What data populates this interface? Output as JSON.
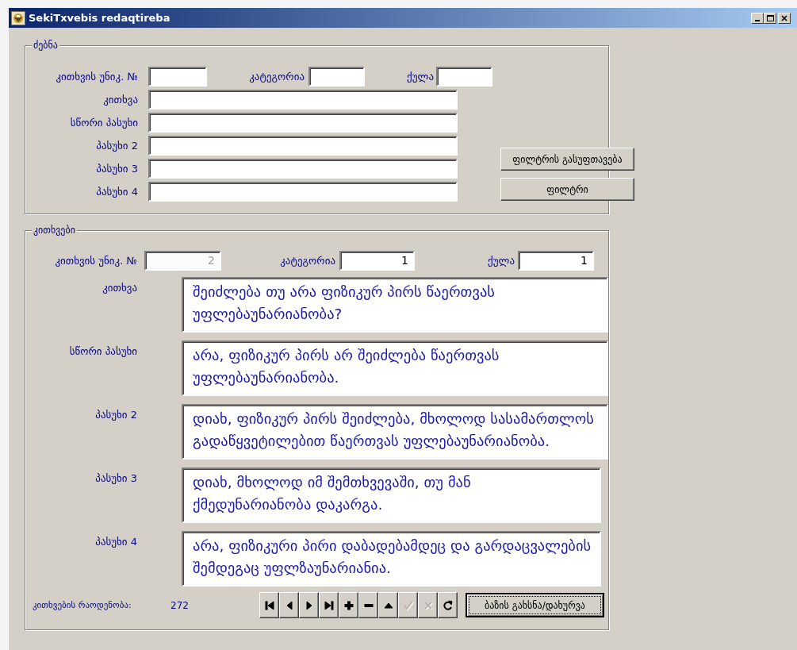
{
  "window": {
    "title": "SekiTxvebis redaqtireba"
  },
  "search": {
    "title": "ძებნა",
    "top_fields": [
      {
        "label": "კითხვის უნიკ. №"
      },
      {
        "label": "კატეგორია"
      },
      {
        "label": "ქულა"
      }
    ],
    "fields": [
      {
        "label": "კითხვა"
      },
      {
        "label": "სწორი პასუხი"
      },
      {
        "label": "პასუხი 2"
      },
      {
        "label": "პასუხი 3"
      },
      {
        "label": "პასუხი 4"
      }
    ],
    "buttons": [
      "ფილტრის გასუფთავება",
      "ფილტრი"
    ]
  },
  "questions": {
    "title": "კითხვები",
    "top_fields": [
      {
        "label": "კითხვის უნიკ. №",
        "value": "2",
        "disabled": true
      },
      {
        "label": "კატეგორია",
        "value": "1",
        "disabled": false
      },
      {
        "label": "ქულა",
        "value": "1",
        "disabled": false
      }
    ],
    "memos": [
      {
        "label": "კითხვა",
        "value": "შეიძლება თუ არა ფიზიკურ პირს წაერთვას უფლებაუნარიანობა?",
        "narrow": false
      },
      {
        "label": "სწორი პასუხი",
        "value": "არა, ფიზიკურ პირს არ შეიძლება წაერთვას უფლებაუნარიანობა.",
        "narrow": false
      },
      {
        "label": "პასუხი 2",
        "value": "დიახ, ფიზიკურ პირს შეიძლება, მხოლოდ სასამართლოს გადაწყვეტილებით წაერთვას უფლებაუნარიანობა.",
        "narrow": false
      },
      {
        "label": "პასუხი 3",
        "value": "დიახ, მხოლოდ იმ შემთხვევაში, თუ მან ქმედუნარიანობა დაკარგა.",
        "narrow": true
      },
      {
        "label": "პასუხი 4",
        "value": "არა, ფიზიკური პირი დაბადებამდეც და გარდაცვალების შემდეგაც უფლზაუნარიანია.",
        "narrow": true
      }
    ],
    "count_label": "კითხვების რაოდენობა:",
    "count": "272",
    "navigator": [
      {
        "kind": "first",
        "disabled": false
      },
      {
        "kind": "prior",
        "disabled": false
      },
      {
        "kind": "next",
        "disabled": false
      },
      {
        "kind": "last",
        "disabled": false
      },
      {
        "kind": "insert",
        "disabled": false
      },
      {
        "kind": "delete",
        "disabled": false
      },
      {
        "kind": "edit",
        "disabled": false
      },
      {
        "kind": "post",
        "disabled": true
      },
      {
        "kind": "cancel",
        "disabled": true
      },
      {
        "kind": "refresh",
        "disabled": false
      }
    ],
    "db_button": "ბაზის გახსნა/დახურვა"
  }
}
